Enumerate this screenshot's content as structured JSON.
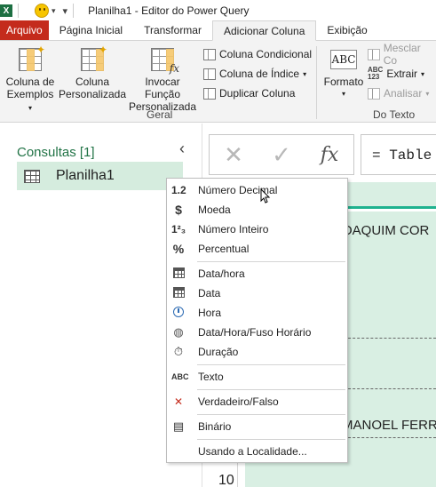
{
  "window": {
    "title": "Planilha1 - Editor do Power Query",
    "app_icon": "excel-icon"
  },
  "ribbon_tabs": [
    "Arquivo",
    "Página Inicial",
    "Transformar",
    "Adicionar Coluna",
    "Exibição"
  ],
  "active_tab": "Adicionar Coluna",
  "ribbon": {
    "col_exemplos": [
      "Coluna de",
      "Exemplos"
    ],
    "col_personalizada": [
      "Coluna",
      "Personalizada"
    ],
    "invocar": [
      "Invocar Função",
      "Personalizada"
    ],
    "coluna_condicional": "Coluna Condicional",
    "coluna_indice": "Coluna de Índice",
    "duplicar_coluna": "Duplicar Coluna",
    "group_geral": "Geral",
    "formato": "Formato",
    "abc_small": "ABC\n123",
    "mesclar": "Mesclar Co",
    "extrair": "Extrair",
    "analisar": "Analisar",
    "group_texto": "Do Texto",
    "abc_icon_text": "ABC"
  },
  "queries": {
    "title": "Consultas [1]",
    "collapse_glyph": "‹",
    "items": [
      {
        "label": "Planilha1"
      }
    ]
  },
  "formula_bar": {
    "cancel_glyph": "✕",
    "confirm_glyph": "✓",
    "fx_glyph": "fx",
    "formula": "= Table"
  },
  "grid": {
    "cells": [
      "OAQUIM COR",
      "MANOEL FERR"
    ],
    "row_number": "10"
  },
  "type_menu": {
    "items": [
      {
        "icon": "1.2",
        "label": "Número Decimal"
      },
      {
        "icon": "$",
        "label": "Moeda"
      },
      {
        "icon": "1²₃",
        "label": "Número Inteiro"
      },
      {
        "icon": "%",
        "label": "Percentual"
      },
      {
        "icon": "calendar-clock",
        "label": "Data/hora"
      },
      {
        "icon": "calendar",
        "label": "Data"
      },
      {
        "icon": "clock",
        "label": "Hora"
      },
      {
        "icon": "globe-clock",
        "label": "Data/Hora/Fuso Horário"
      },
      {
        "icon": "stopwatch",
        "label": "Duração"
      },
      {
        "icon": "ABC",
        "label": "Texto"
      },
      {
        "icon": "true-false",
        "label": "Verdadeiro/Falso"
      },
      {
        "icon": "binary",
        "label": "Binário"
      },
      {
        "icon": "",
        "label": "Usando a Localidade..."
      }
    ]
  }
}
